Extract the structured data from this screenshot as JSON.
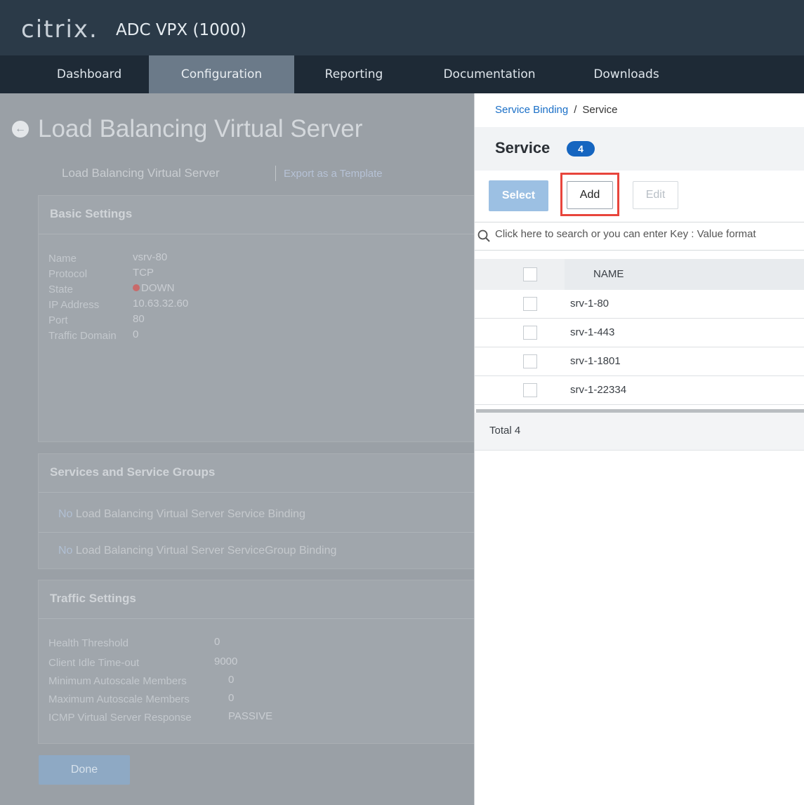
{
  "header": {
    "logo": "citrix.",
    "product": "ADC VPX (1000)"
  },
  "nav": {
    "tabs": [
      {
        "label": "Dashboard",
        "active": false
      },
      {
        "label": "Configuration",
        "active": true
      },
      {
        "label": "Reporting",
        "active": false
      },
      {
        "label": "Documentation",
        "active": false
      },
      {
        "label": "Downloads",
        "active": false
      }
    ]
  },
  "background": {
    "title": "Load Balancing Virtual Server",
    "subtitle": "Load Balancing Virtual Server",
    "export_link": "Export as a Template",
    "basic_settings": {
      "heading": "Basic Settings",
      "fields": [
        {
          "label": "Name",
          "value": "vsrv-80"
        },
        {
          "label": "Protocol",
          "value": "TCP"
        },
        {
          "label": "State",
          "value": "DOWN"
        },
        {
          "label": "IP Address",
          "value": "10.63.32.60"
        },
        {
          "label": "Port",
          "value": "80"
        },
        {
          "label": "Traffic Domain",
          "value": "0"
        }
      ]
    },
    "services": {
      "heading": "Services and Service Groups",
      "service_binding_prefix": "No",
      "service_binding": "Load Balancing Virtual Server Service Binding",
      "group_binding_prefix": "No",
      "group_binding": "Load Balancing Virtual Server ServiceGroup Binding"
    },
    "traffic_settings": {
      "heading": "Traffic Settings",
      "fields": [
        {
          "label": "Health Threshold",
          "value": "0"
        },
        {
          "label": "Client Idle Time-out",
          "value": "9000"
        },
        {
          "label": "Minimum Autoscale Members",
          "value": "0"
        },
        {
          "label": "Maximum Autoscale Members",
          "value": "0"
        },
        {
          "label": "ICMP Virtual Server Response",
          "value": "PASSIVE"
        }
      ]
    },
    "done_button": "Done"
  },
  "panel": {
    "breadcrumb": {
      "link": "Service Binding",
      "separator": "/",
      "current": "Service"
    },
    "title": "Service",
    "count": "4",
    "buttons": {
      "select": "Select",
      "add": "Add",
      "edit": "Edit"
    },
    "search": {
      "placeholder": "Click here to search or you can enter Key : Value format"
    },
    "table": {
      "column": "NAME",
      "rows": [
        "srv-1-80",
        "srv-1-443",
        "srv-1-1801",
        "srv-1-22334"
      ]
    },
    "total": "Total 4"
  },
  "colors": {
    "header_bg": "#2b3a48",
    "accent": "#1565c0",
    "highlight": "#e8453c"
  }
}
